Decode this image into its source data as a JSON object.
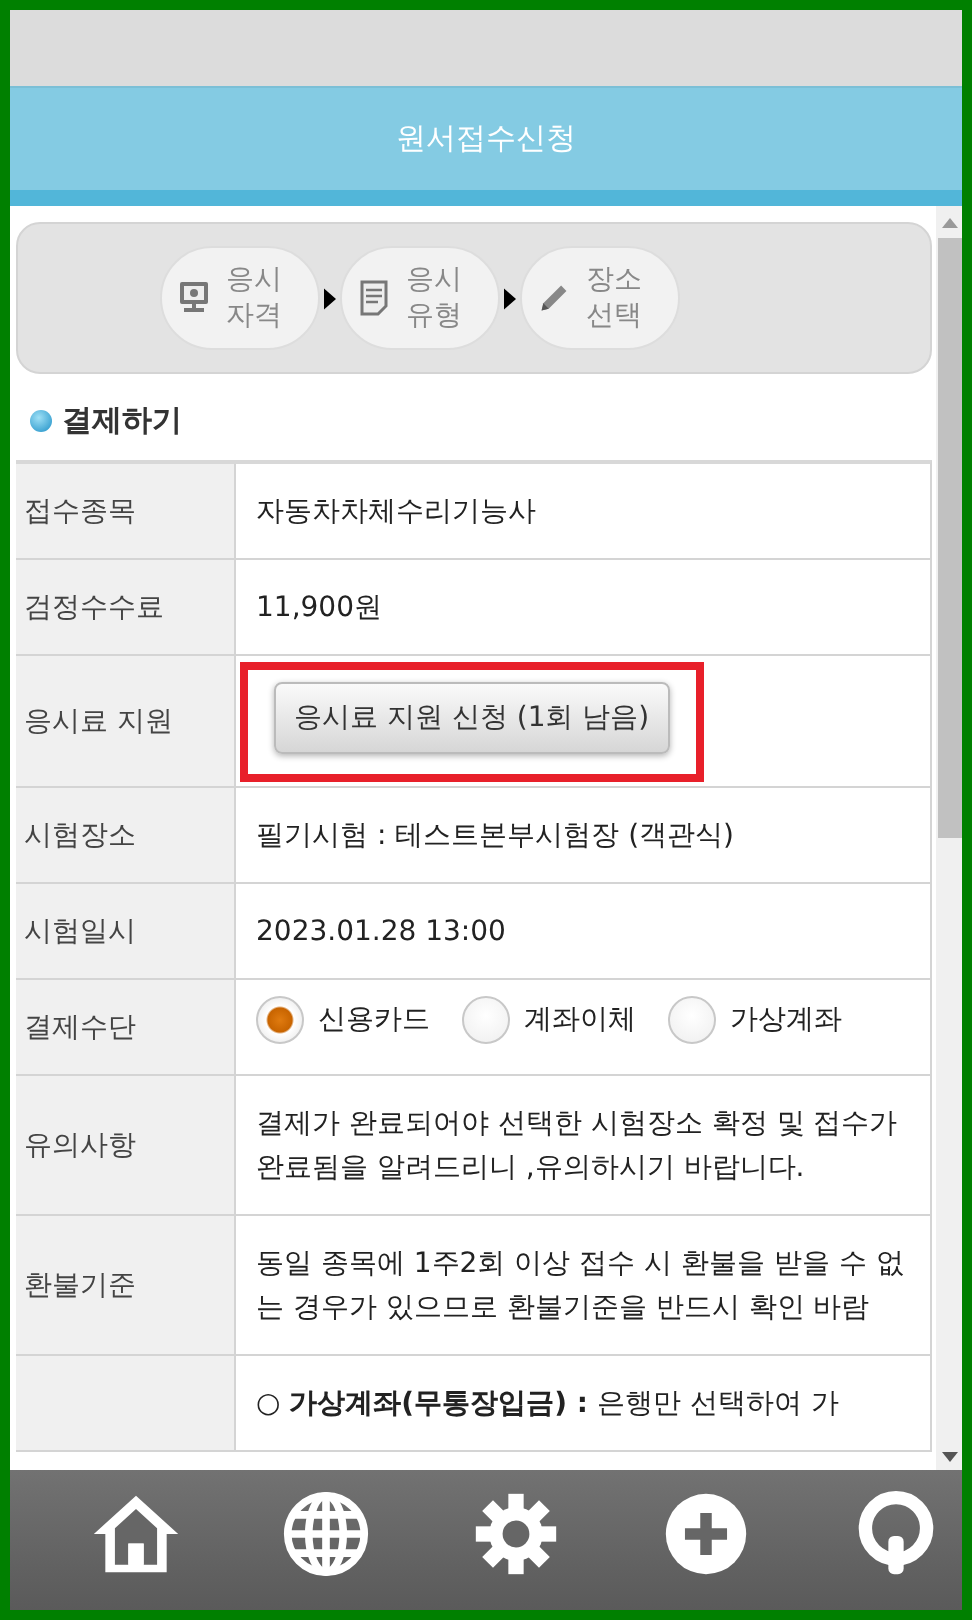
{
  "header": {
    "title": "원서접수신청"
  },
  "steps": [
    {
      "kind": "qualification",
      "label": "응시\n자격"
    },
    {
      "kind": "type",
      "label": "응시\n유형"
    },
    {
      "kind": "place",
      "label": "장소\n선택"
    }
  ],
  "section": {
    "title": "결제하기"
  },
  "rows": [
    {
      "kind": "text",
      "label": "접수종목",
      "value": "자동차차체수리기능사"
    },
    {
      "kind": "text",
      "label": "검정수수료",
      "value": "11,900원"
    },
    {
      "kind": "button",
      "label": "응시료 지원",
      "value": "응시료 지원 신청 (1회 남음)",
      "highlighted": true
    },
    {
      "kind": "text",
      "label": "시험장소",
      "value": "필기시험 : 테스트본부시험장 (객관식)"
    },
    {
      "kind": "text",
      "label": "시험일시",
      "value": "2023.01.28 13:00"
    },
    {
      "kind": "radio",
      "label": "결제수단",
      "options": [
        {
          "label": "신용카드",
          "selected": true
        },
        {
          "label": "계좌이체",
          "selected": false
        },
        {
          "label": "가상계좌",
          "selected": false
        }
      ]
    },
    {
      "kind": "text",
      "label": "유의사항",
      "value": "결제가 완료되어야 선택한 시험장소 확정 및 접수가 완료됨을 알려드리니 ,유의하시기 바랍니다."
    },
    {
      "kind": "text",
      "label": "환불기준",
      "value": "동일 종목에 1주2회 이상 접수 시 환불을 받을 수 없는 경우가 있으므로 환불기준을 반드시 확인 바람"
    },
    {
      "kind": "text",
      "label": "",
      "value": "○ **가상계좌(무통장입금) :** 은행만 선택하여 가"
    }
  ],
  "nav": [
    {
      "kind": "home"
    },
    {
      "kind": "globe"
    },
    {
      "kind": "gear"
    },
    {
      "kind": "plus"
    },
    {
      "kind": "power"
    }
  ]
}
